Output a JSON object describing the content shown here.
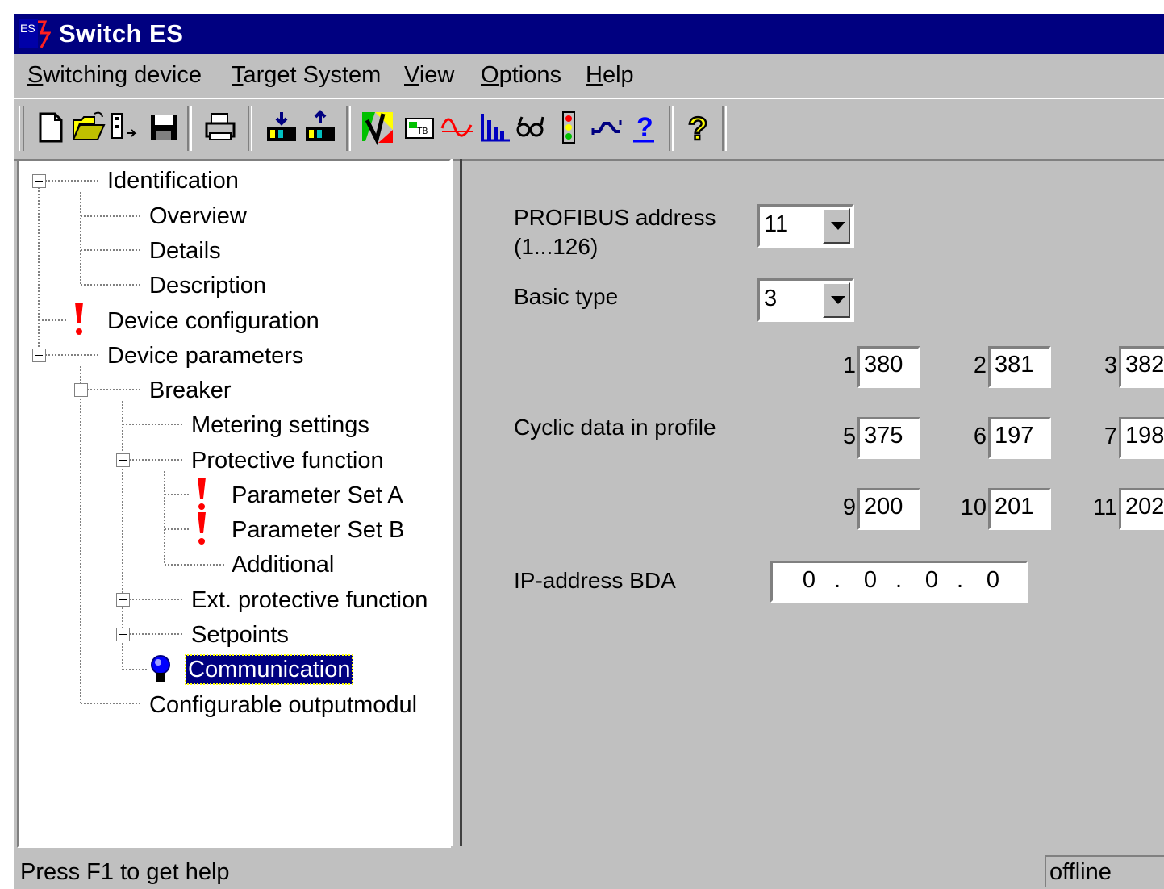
{
  "window": {
    "title": "Switch ES",
    "icon_text": "ES"
  },
  "menu": [
    {
      "pre": "",
      "key": "S",
      "post": "witching device"
    },
    {
      "pre": "",
      "key": "T",
      "post": "arget System"
    },
    {
      "pre": "",
      "key": "V",
      "post": "iew"
    },
    {
      "pre": "",
      "key": "O",
      "post": "ptions"
    },
    {
      "pre": "",
      "key": "H",
      "post": "elp"
    }
  ],
  "toolbar": {
    "icons": [
      "new-file-icon",
      "open-folder-icon",
      "open-device-icon",
      "save-icon",
      "print-icon",
      "load-to-device-icon",
      "load-from-device-icon",
      "commissioning-icon",
      "test-icon",
      "trace-icon",
      "statistics-icon",
      "observe-icon",
      "traffic-light-icon",
      "switch-icon",
      "help-icon",
      "context-help-icon"
    ]
  },
  "tree": {
    "nodes": [
      {
        "label": "Identification"
      },
      {
        "label": "Overview"
      },
      {
        "label": "Details"
      },
      {
        "label": "Description"
      },
      {
        "label": "Device configuration"
      },
      {
        "label": "Device parameters"
      },
      {
        "label": "Breaker"
      },
      {
        "label": "Metering settings"
      },
      {
        "label": "Protective function"
      },
      {
        "label": "Parameter Set A"
      },
      {
        "label": "Parameter Set B"
      },
      {
        "label": "Additional"
      },
      {
        "label": "Ext. protective function"
      },
      {
        "label": "Setpoints"
      },
      {
        "label": "Communication"
      },
      {
        "label": "Configurable outputmodul"
      }
    ],
    "warning_color": "#ff0000",
    "selected_color": "#000080"
  },
  "panel": {
    "profibus_label_1": "PROFIBUS address",
    "profibus_label_2": "(1...126)",
    "profibus_value": "11",
    "basic_type_label": "Basic type",
    "basic_type_value": "3",
    "cyclic_label": "Cyclic data in profile",
    "cyclic": [
      {
        "index": "1",
        "value": "380"
      },
      {
        "index": "2",
        "value": "381"
      },
      {
        "index": "3",
        "value": "382"
      },
      {
        "index": "5",
        "value": "375"
      },
      {
        "index": "6",
        "value": "197"
      },
      {
        "index": "7",
        "value": "198"
      },
      {
        "index": "9",
        "value": "200"
      },
      {
        "index": "10",
        "value": "201"
      },
      {
        "index": "11",
        "value": "202"
      }
    ],
    "ip_label": "IP-address BDA",
    "ip_octets": [
      "0",
      "0",
      "0",
      "0"
    ],
    "ip_separator": "."
  },
  "status": {
    "text": "Press F1 to get help",
    "mode": "offline"
  }
}
